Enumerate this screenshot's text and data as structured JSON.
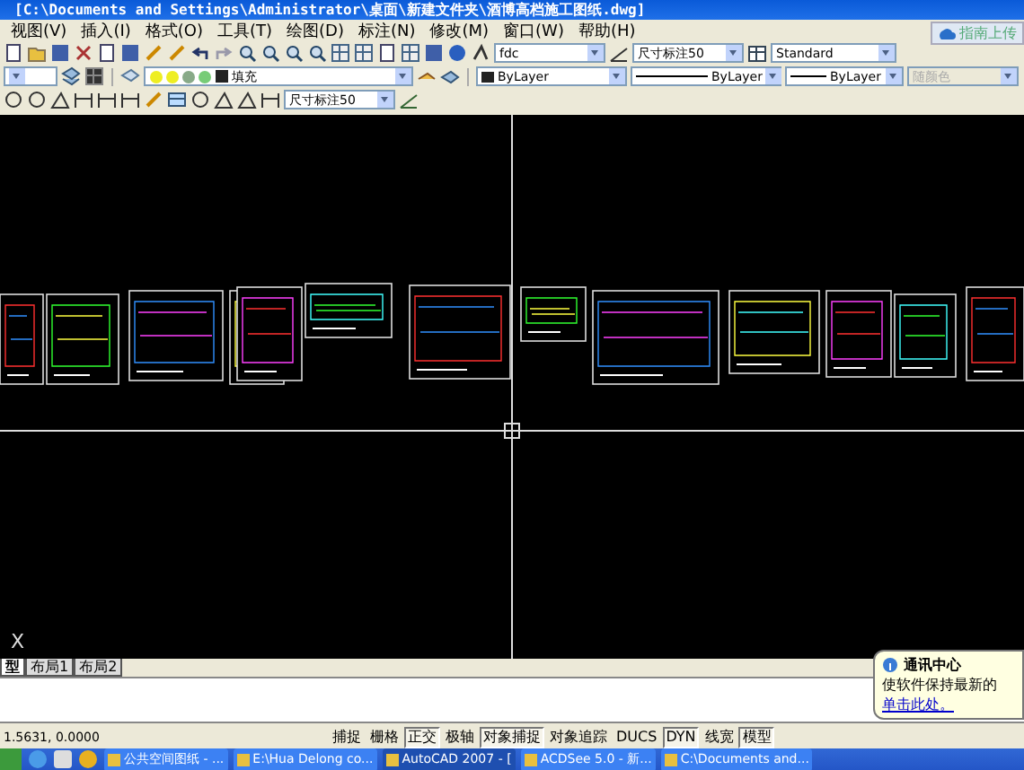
{
  "window": {
    "title": "[C:\\Documents and Settings\\Administrator\\桌面\\新建文件夹\\酒博高档施工图纸.dwg]"
  },
  "menu": [
    "视图(V)",
    "插入(I)",
    "格式(O)",
    "工具(T)",
    "绘图(D)",
    "标注(N)",
    "修改(M)",
    "窗口(W)",
    "帮助(H)"
  ],
  "upload_button": {
    "label": "指南上传"
  },
  "toolbar_1": {
    "text_style": "fdc",
    "dim_style": "尺寸标注50",
    "table_style": "Standard"
  },
  "toolbar_2": {
    "layer": "填充",
    "color_control": "ByLayer",
    "linetype": "ByLayer",
    "lineweight": "ByLayer",
    "plot_style": {
      "value": "随颜色",
      "disabled": true
    }
  },
  "toolbar_3": {
    "dim_style": "尺寸标注50"
  },
  "canvas": {
    "ucs_label": "X"
  },
  "layout_tabs": [
    {
      "label": "型",
      "selected": true
    },
    {
      "label": "布局1",
      "selected": false
    },
    {
      "label": "布局2",
      "selected": false
    }
  ],
  "status_bar": {
    "coordinates": "1.5631, 0.0000",
    "toggles": [
      {
        "label": "捕捉",
        "on": false
      },
      {
        "label": "栅格",
        "on": false
      },
      {
        "label": "正交",
        "on": true
      },
      {
        "label": "极轴",
        "on": false
      },
      {
        "label": "对象捕捉",
        "on": true
      },
      {
        "label": "对象追踪",
        "on": false
      },
      {
        "label": "DUCS",
        "on": false
      },
      {
        "label": "DYN",
        "on": true
      },
      {
        "label": "线宽",
        "on": false
      },
      {
        "label": "模型",
        "on": true
      }
    ]
  },
  "balloon": {
    "title": "通讯中心",
    "message": "使软件保持最新的",
    "link": "单击此处。"
  },
  "taskbar": {
    "tasks": [
      {
        "label": "公共空间图纸 - ...",
        "selected": false
      },
      {
        "label": "E:\\Hua Delong co...",
        "selected": false
      },
      {
        "label": "AutoCAD 2007 - [",
        "selected": true
      },
      {
        "label": "ACDSee 5.0 - 新...",
        "selected": false
      },
      {
        "label": "C:\\Documents and...",
        "selected": false
      }
    ]
  }
}
